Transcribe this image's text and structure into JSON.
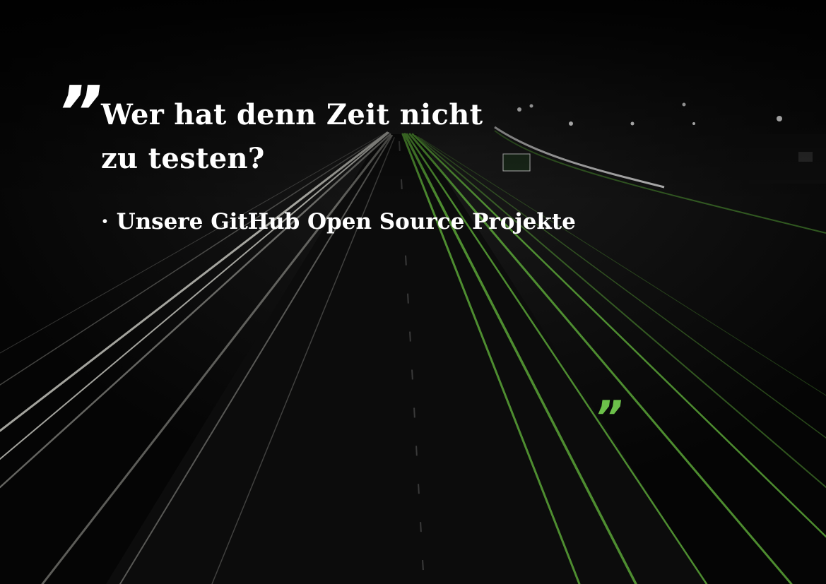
{
  "headline": {
    "line1": "Wer hat denn Zeit nicht",
    "line2": "zu testen?"
  },
  "bullet": {
    "marker": "·",
    "text": "Unsere GitHub Open Source Projekte"
  },
  "quote_marks": {
    "open": "”",
    "close": "”"
  },
  "colors": {
    "background": "#050505",
    "text": "#ffffff",
    "accent": "#6cc04a",
    "light_trail_white": "#d8d8d0",
    "light_trail_green": "#5fae3a"
  }
}
